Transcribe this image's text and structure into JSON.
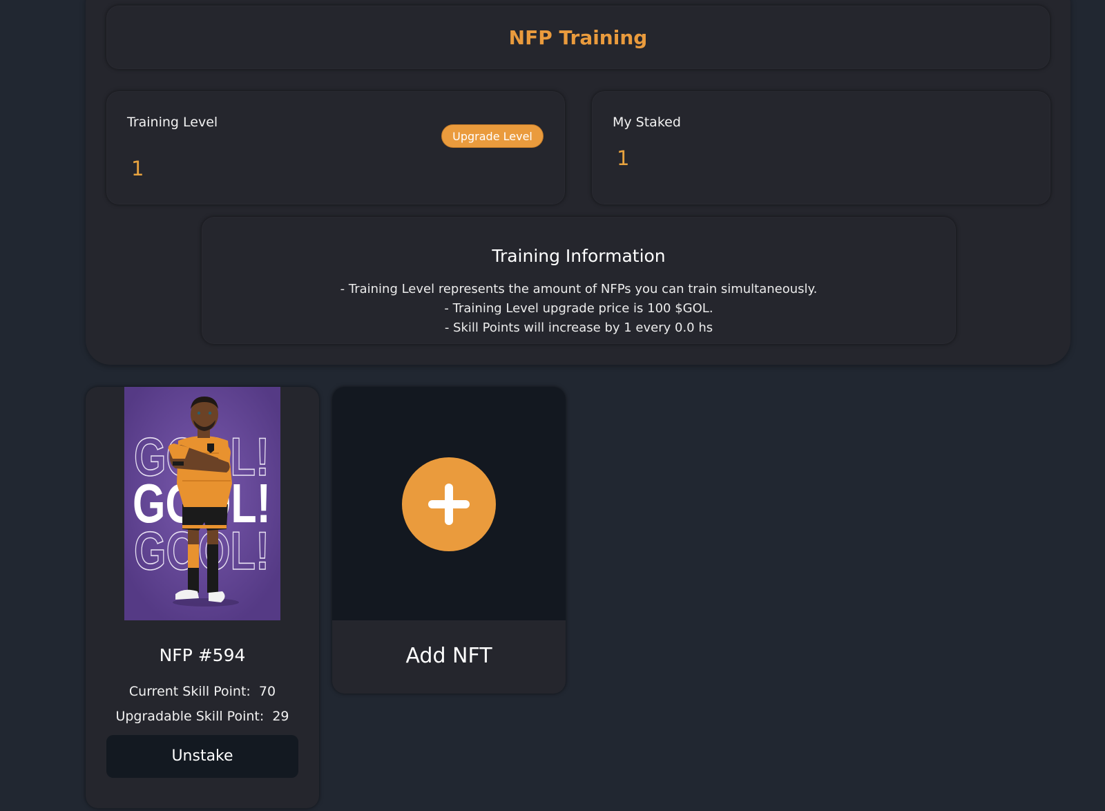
{
  "header": {
    "title": "NFP Training"
  },
  "training_level": {
    "label": "Training Level",
    "value": "1",
    "upgrade_button": "Upgrade Level"
  },
  "my_staked": {
    "label": "My Staked",
    "value": "1"
  },
  "training_info": {
    "title": "Training Information",
    "lines": [
      "- Training Level represents the amount of NFPs you can train simultaneously.",
      "- Training Level upgrade price is 100 $GOL.",
      "- Skill Points will increase by 1 every 0.0 hs"
    ]
  },
  "nft_card": {
    "name": "NFP #594",
    "current_skill_label": "Current Skill Point:",
    "current_skill_value": "70",
    "upgradable_skill_label": "Upgradable Skill Point:",
    "upgradable_skill_value": "29",
    "unstake_button": "Unstake",
    "image_text": [
      "GOOL!",
      "GOOL!",
      "GOOL!"
    ]
  },
  "add_card": {
    "label": "Add NFT",
    "icon": "plus-icon"
  },
  "colors": {
    "accent": "#ea9b3d",
    "background": "#212731",
    "panel": "#25262d",
    "dark_button": "#131921"
  }
}
